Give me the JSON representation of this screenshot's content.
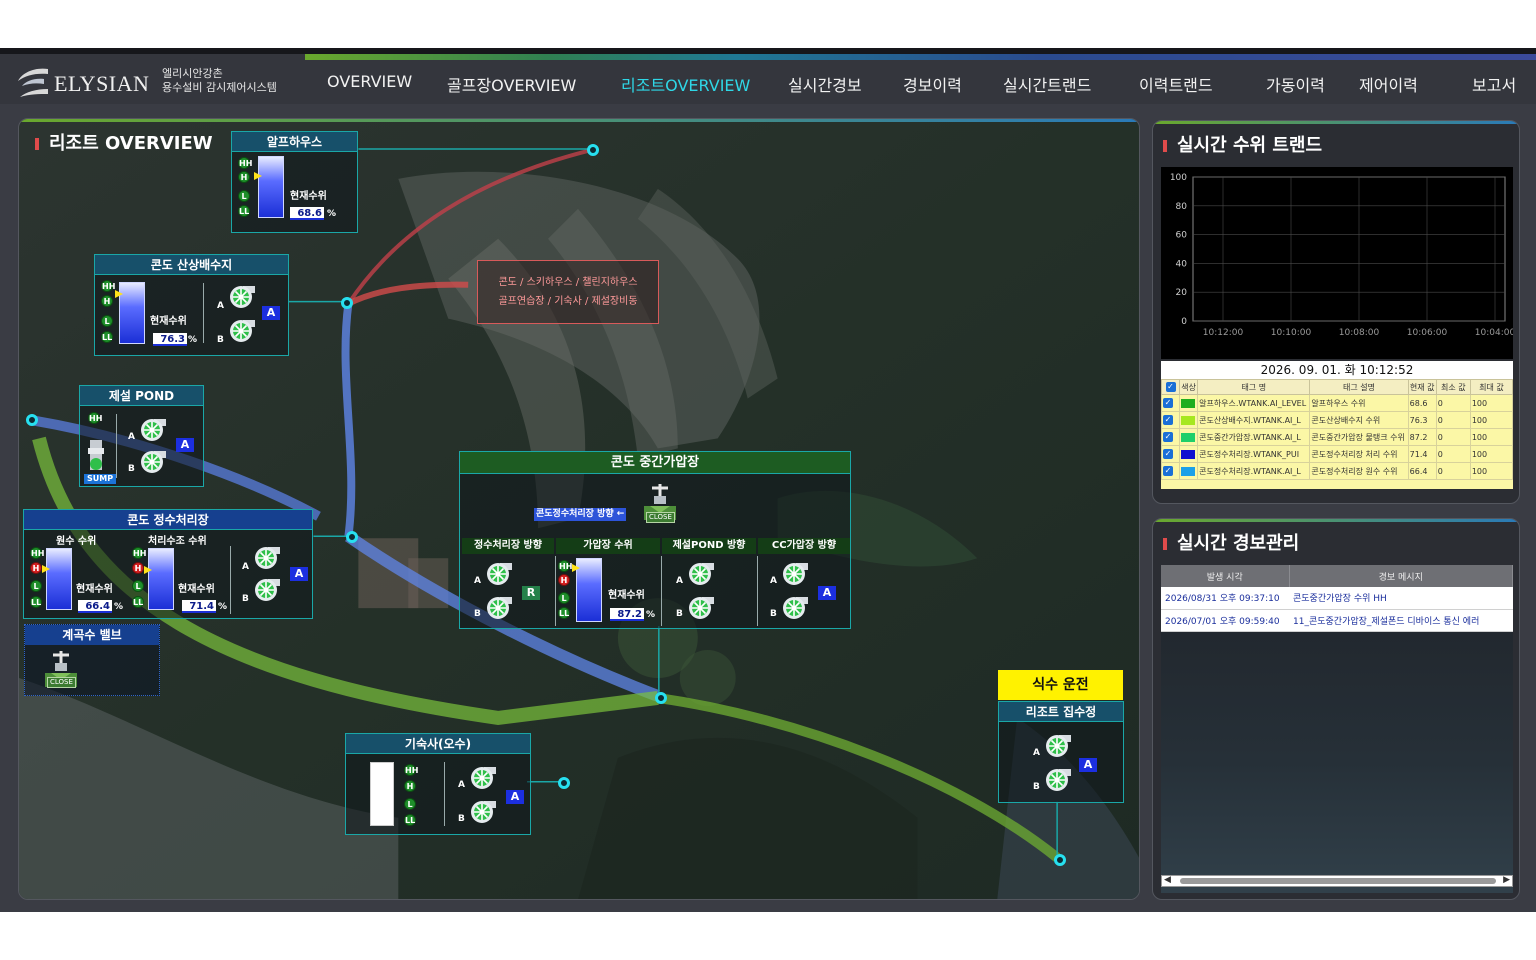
{
  "brand": {
    "name": "ELYSIAN",
    "sub_line1": "엘리시안강촌",
    "sub_line2": "용수설비 감시제어시스템"
  },
  "nav": [
    {
      "label": "OVERVIEW",
      "active": false
    },
    {
      "label": "골프장OVERVIEW",
      "active": false
    },
    {
      "label": "리조트OVERVIEW",
      "active": true
    },
    {
      "label": "실시간경보",
      "active": false
    },
    {
      "label": "경보이력",
      "active": false
    },
    {
      "label": "실시간트랜드",
      "active": false
    },
    {
      "label": "이력트랜드",
      "active": false
    },
    {
      "label": "가동이력",
      "active": false
    },
    {
      "label": "제어이력",
      "active": false
    },
    {
      "label": "보고서",
      "active": false
    }
  ],
  "main": {
    "title": "리조트 OVERVIEW",
    "route_text_line1": "콘도 / 스키하우스 / 챌린지하우스",
    "route_text_line2": "골프연습장 / 기숙사 / 제설장비동",
    "current_level_label": "현재수위",
    "pct": "%",
    "alps": {
      "title": "알프하우스",
      "level": "68.6",
      "fill": 0.686
    },
    "condo_up": {
      "title": "콘도 산상배수지",
      "level": "76.3",
      "fill": 0.763
    },
    "snow_pond": {
      "title": "제설 POND",
      "sump": "SUMP"
    },
    "purify": {
      "title": "콘도 정수처리장",
      "raw_label": "원수 수위",
      "treated_label": "처리수조 수위",
      "raw_level": "66.4",
      "treated_level": "71.4",
      "raw_fill": 0.664,
      "treated_fill": 0.714
    },
    "valve_box": {
      "title": "계곡수 밸브",
      "valve_state": "CLOSE"
    },
    "mid_station": {
      "title": "콘도 중간가압장",
      "direction": "콘도정수처리장 방향 ←",
      "valve_state": "CLOSE",
      "sub1": "정수처리장 방향",
      "sub2": "가압장 수위",
      "sub3": "제설POND 방향",
      "sub4": "CC가압장 방향",
      "level": "87.2",
      "fill": 0.872,
      "badge_r": "R"
    },
    "dorm": {
      "title": "기숙사(오수)"
    },
    "run_status": "식수 운전",
    "resort_well": {
      "title": "리조트 집수정"
    },
    "pump_a": "A",
    "pump_b": "B",
    "badge_a": "A",
    "lamps": [
      "HH",
      "H",
      "L",
      "LL"
    ]
  },
  "trend": {
    "title": "실시간 수위 트랜드",
    "timestamp": "2026. 09. 01. 화 10:12:52",
    "columns": [
      "색상",
      "태그 명",
      "태그 설명",
      "현재 값",
      "최소 값",
      "최대 값"
    ],
    "rows": [
      {
        "color": "#1fae1f",
        "tag": "알프하우스.WTANK.AI_LEVEL",
        "desc": "알프하우스 수위",
        "cur": "68.6",
        "min": "0",
        "max": "100"
      },
      {
        "color": "#a6e81f",
        "tag": "콘도산상배수지.WTANK.AI_L",
        "desc": "콘도산상배수지 수위",
        "cur": "76.3",
        "min": "0",
        "max": "100"
      },
      {
        "color": "#1fcf6a",
        "tag": "콘도중간가압장.WTANK.AI_L",
        "desc": "콘도중간가압장 물탱크 수위",
        "cur": "87.2",
        "min": "0",
        "max": "100"
      },
      {
        "color": "#1010d0",
        "tag": "콘도정수처리장.WTANK_PUI",
        "desc": "콘도정수처리장 처리 수위",
        "cur": "71.4",
        "min": "0",
        "max": "100"
      },
      {
        "color": "#1aa0e8",
        "tag": "콘도정수처리장.WTANK.AI_L",
        "desc": "콘도정수처리장 원수 수위",
        "cur": "66.4",
        "min": "0",
        "max": "100"
      }
    ]
  },
  "chart_data": {
    "type": "line",
    "title": "",
    "xlabel": "",
    "ylabel": "",
    "x_ticks": [
      "10:12:00",
      "10:10:00",
      "10:08:00",
      "10:06:00",
      "10:04:00"
    ],
    "y_ticks": [
      "100",
      "80",
      "60",
      "40",
      "20",
      "0"
    ],
    "ylim": [
      0,
      100
    ],
    "grid": true,
    "series": []
  },
  "alarm": {
    "title": "실시간 경보관리",
    "columns": [
      "발생 시각",
      "경보 메시지"
    ],
    "rows": [
      {
        "time": "2026/08/31 오후 09:37:10",
        "msg": "콘도중간가압장 수위 HH"
      },
      {
        "time": "2026/07/01 오후 09:59:40",
        "msg": "11_콘도중간가압장_제설폰드 디바이스 통신 에러"
      }
    ]
  }
}
